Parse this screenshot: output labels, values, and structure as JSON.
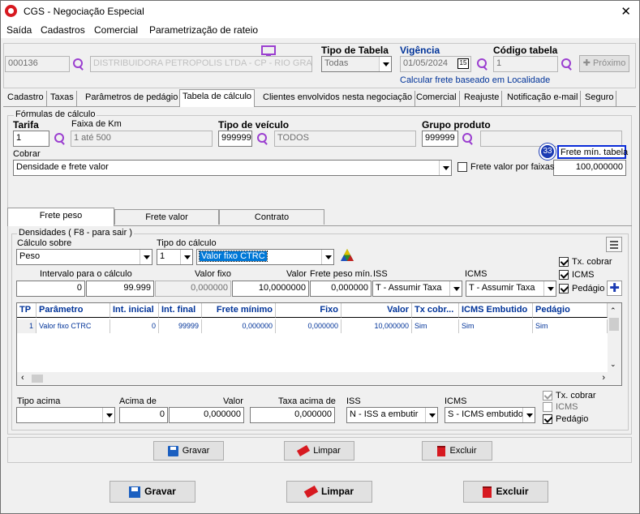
{
  "window": {
    "title": "CGS - Negociação Especial",
    "close": "✕"
  },
  "menu": [
    "Saída",
    "Cadastros",
    "Comercial",
    "Parametrização de rateio"
  ],
  "header": {
    "code": "000136",
    "name": "DISTRIBUIDORA PETROPOLIS LTDA - CP - RIO GRANDE",
    "tipo_tabela_label": "Tipo de Tabela",
    "tipo_tabela_value": "Todas",
    "vigencia_label": "Vigência",
    "vigencia_value": "01/05/2024",
    "codigo_tabela_label": "Código tabela",
    "codigo_tabela_value": "1",
    "proximo": "Próximo",
    "calcular_link": "Calcular frete baseado em Localidade"
  },
  "tabs": [
    "Cadastro",
    "Taxas",
    "Parâmetros de pedágio",
    "Tabela de cálculo",
    "Clientes envolvidos nesta negociação",
    "Comercial",
    "Reajuste",
    "Notificação e-mail",
    "Seguro"
  ],
  "formulas": {
    "group_label": "Fórmulas de cálculo",
    "tarifa_label": "Tarifa",
    "tarifa_value": "1",
    "faixa_label": "Faixa de Km",
    "faixa_value": "1 até 500",
    "tipo_veiculo_label": "Tipo de veículo",
    "tipo_veiculo_code": "999999",
    "tipo_veiculo_value": "TODOS",
    "grupo_label": "Grupo produto",
    "grupo_code": "999999",
    "grupo_value": "",
    "badge": "33",
    "frete_min_label": "Frete mín. tabela",
    "frete_min_value": "100,000000",
    "cobrar_label": "Cobrar",
    "cobrar_value": "Densidade e frete valor",
    "frete_faixas_label": "Frete valor por faixas"
  },
  "subtabs": [
    "Frete peso",
    "Frete valor",
    "Contrato"
  ],
  "densidades": {
    "group_label": "Densidades ( F8 - para sair )",
    "calculo_sobre_label": "Cálculo sobre",
    "calculo_sobre_value": "Peso",
    "tipo_calculo_label": "Tipo do cálculo",
    "tipo_calculo_num": "1",
    "tipo_calculo_value": "Valor fixo CTRC",
    "tx_cobrar": "Tx. cobrar",
    "icms": "ICMS",
    "pedagio": "Pedágio",
    "intervalo_label": "Intervalo para o cálculo",
    "int_ini": "0",
    "int_fim": "99.999",
    "valor_fixo_label": "Valor fixo",
    "valor_fixo_value": "0,000000",
    "valor_label": "Valor",
    "valor_value": "10,0000000",
    "frete_peso_min_label": "Frete peso mín.",
    "frete_peso_min_value": "0,000000",
    "iss_label": "ISS",
    "iss_value": "T - Assumir Taxa",
    "icms_label": "ICMS",
    "icms_value": "T - Assumir Taxa"
  },
  "grid": {
    "headers": [
      "TP",
      "Parâmetro",
      "Int. inicial",
      "Int. final",
      "Frete mínimo",
      "Fixo",
      "Valor",
      "Tx cobr...",
      "ICMS Embutido",
      "Pedágio"
    ],
    "rows": [
      [
        "1",
        "Valor fixo CTRC",
        "0",
        "99999",
        "0,000000",
        "0,000000",
        "10,000000",
        "Sim",
        "Sim",
        "Sim"
      ]
    ]
  },
  "acima": {
    "tipo_acima_label": "Tipo acima",
    "tipo_acima_value": "",
    "acima_de_label": "Acima de",
    "acima_de_value": "0",
    "valor_label": "Valor",
    "valor_value": "0,000000",
    "taxa_acima_label": "Taxa acima de",
    "taxa_acima_value": "0,000000",
    "iss_label": "ISS",
    "iss_value": "N - ISS a embutir",
    "icms_label": "ICMS",
    "icms_value": "S - ICMS embutido",
    "tx_cobrar": "Tx. cobrar",
    "icms": "ICMS",
    "pedagio": "Pedágio"
  },
  "inner_buttons": {
    "gravar": "Gravar",
    "limpar": "Limpar",
    "excluir": "Excluir"
  },
  "footer_buttons": {
    "gravar": "Gravar",
    "limpar": "Limpar",
    "excluir": "Excluir"
  },
  "colors": {
    "accent": "#003399",
    "magnifier": "#9b3fd0",
    "excluir": "#d71920"
  }
}
